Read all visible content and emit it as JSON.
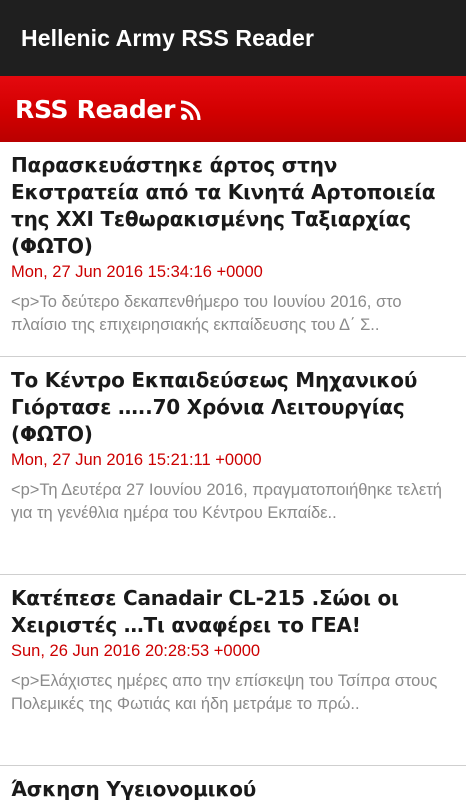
{
  "app": {
    "title": "Hellenic Army RSS Reader"
  },
  "banner": {
    "label": "RSS Reader",
    "icon": "rss-icon"
  },
  "colors": {
    "appbar": "#1f1f1f",
    "banner": "#d20000",
    "date": "#cc0000",
    "description": "#8a8a8a"
  },
  "feed": {
    "items": [
      {
        "title": "Παρασκευάστηκε άρτος στην Εκστρατεία από τα Κινητά Αρτοποιεία της ΧΧΙ Τεθωρακισμένης Ταξιαρχίας (ΦΩΤΟ)",
        "date": "Mon, 27 Jun 2016 15:34:16 +0000",
        "description": "<p>Το δεύτερο δεκαπενθήμερο του Ιουνίου 2016, στο πλαίσιο της επιχειρησιακής εκπαίδευσης του Δ΄ Σ.."
      },
      {
        "title": "Το Κέντρο Εκπαιδεύσεως Μηχανικού Γιόρτασε …..70 Χρόνια Λειτουργίας (ΦΩΤΟ)",
        "date": "Mon, 27 Jun 2016 15:21:11 +0000",
        "description": "<p>Τη Δευτέρα 27 Ιουνίου 2016, πραγματοποιήθηκε  τελετή για τη γενέθλια ημέρα του Κέντρου Εκπαίδε.."
      },
      {
        "title": "Κατέπεσε Canadair CL-215 .Σώοι οι Χειριστές …Τι αναφέρει το ΓΕΑ!",
        "date": "Sun, 26 Jun 2016 20:28:53 +0000",
        "description": "<p>Ελάχιστες ημέρες απο την επίσκεψη του Τσίπρα στους Πολεμικές της Φωτιάς και ήδη μετράμε το πρώ.."
      },
      {
        "title": "Άσκηση Υγειονομικού"
      }
    ]
  }
}
